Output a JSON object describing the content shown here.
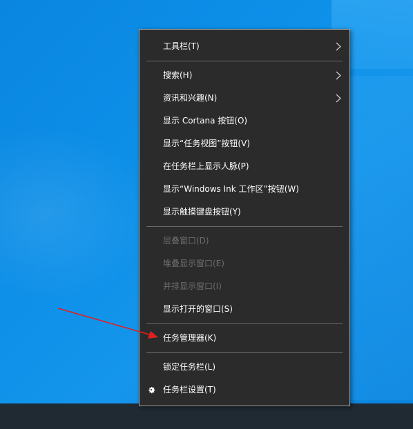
{
  "context_menu": {
    "items": [
      {
        "label": "工具栏(T)",
        "submenu": true,
        "enabled": true
      },
      {
        "label": "搜索(H)",
        "submenu": true,
        "enabled": true
      },
      {
        "label": "资讯和兴趣(N)",
        "submenu": true,
        "enabled": true
      },
      {
        "label": "显示 Cortana 按钮(O)",
        "enabled": true
      },
      {
        "label": "显示“任务视图”按钮(V)",
        "enabled": true
      },
      {
        "label": "在任务栏上显示人脉(P)",
        "enabled": true
      },
      {
        "label": "显示“Windows Ink 工作区”按钮(W)",
        "enabled": true
      },
      {
        "label": "显示触摸键盘按钮(Y)",
        "enabled": true
      },
      {
        "label": "层叠窗口(D)",
        "enabled": false
      },
      {
        "label": "堆叠显示窗口(E)",
        "enabled": false
      },
      {
        "label": "并排显示窗口(I)",
        "enabled": false
      },
      {
        "label": "显示打开的窗口(S)",
        "enabled": true
      },
      {
        "label": "任务管理器(K)",
        "enabled": true
      },
      {
        "label": "锁定任务栏(L)",
        "enabled": true
      },
      {
        "label": "任务栏设置(T)",
        "enabled": true,
        "icon": "gear-icon"
      }
    ]
  },
  "colors": {
    "menu_background": "#2b2b2b",
    "menu_text": "#ffffff",
    "menu_disabled_text": "#6e6e6e",
    "separator": "#6a6a6a",
    "annotation_arrow": "#e02020",
    "desktop": "#0d8fe8",
    "taskbar": "#1f2a33"
  },
  "annotation": {
    "type": "arrow",
    "points_to": "任务管理器(K)"
  }
}
